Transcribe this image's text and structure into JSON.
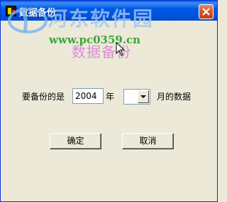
{
  "window": {
    "title": "数据备份",
    "close_glyph": "×"
  },
  "watermark": {
    "name": "河东软件园",
    "url": "www.pc0359.cn",
    "subtitle": "数据备份"
  },
  "form": {
    "prefix_label": "要备份的是",
    "year_value": "2004",
    "year_unit_label": "年",
    "month_value": "",
    "month_suffix_label": "月的数据"
  },
  "buttons": {
    "ok_label": "确定",
    "cancel_label": "取消"
  },
  "icons": {
    "app": "app-icon",
    "close": "close-icon",
    "dropdown": "chevron-down-icon",
    "cursor": "mouse-cursor-icon"
  },
  "colors": {
    "titlebar": "#0058e6",
    "window_bg": "#ece9d8",
    "close_button": "#d75a2f",
    "watermark_url": "#3aa63a"
  }
}
